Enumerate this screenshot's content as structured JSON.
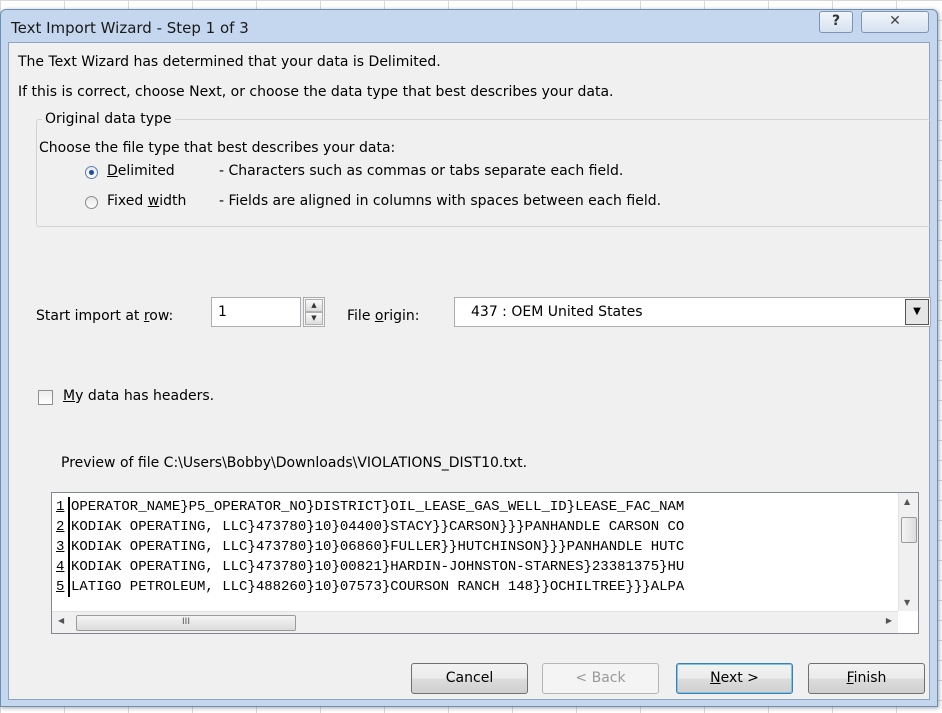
{
  "window": {
    "title": "Text Import Wizard - Step 1 of 3",
    "help_glyph": "?",
    "close_glyph": "✕"
  },
  "intro": {
    "line1": "The Text Wizard has determined that your data is Delimited.",
    "line2": "If this is correct, choose Next, or choose the data type that best describes your data."
  },
  "data_type": {
    "group_label": "Original data type",
    "prompt": "Choose the file type that best describes your data:",
    "options": [
      {
        "mnemonic": "D",
        "label_rest": "elimited",
        "description": "- Characters such as commas or tabs separate each field.",
        "selected": true
      },
      {
        "label_pre": "Fixed ",
        "mnemonic": "w",
        "label_rest": "idth",
        "description": "- Fields are aligned in columns with spaces between each field.",
        "selected": false
      }
    ]
  },
  "start_row": {
    "label_pre": "Start import at ",
    "mnemonic": "r",
    "label_rest": "ow:",
    "value": "1"
  },
  "file_origin": {
    "label_pre": "File ",
    "mnemonic": "o",
    "label_rest": "rigin:",
    "value": "437 : OEM United States"
  },
  "headers": {
    "mnemonic": "M",
    "label_rest": "y data has headers.",
    "checked": false
  },
  "preview": {
    "label": "Preview of file C:\\Users\\Bobby\\Downloads\\VIOLATIONS_DIST10.txt.",
    "rows": [
      {
        "n": "1",
        "text": "OPERATOR_NAME}P5_OPERATOR_NO}DISTRICT}OIL_LEASE_GAS_WELL_ID}LEASE_FAC_NAM"
      },
      {
        "n": "2",
        "text": "KODIAK OPERATING, LLC}473780}10}04400}STACY}}CARSON}}}PANHANDLE CARSON CO"
      },
      {
        "n": "3",
        "text": "KODIAK OPERATING, LLC}473780}10}06860}FULLER}}HUTCHINSON}}}PANHANDLE HUTC"
      },
      {
        "n": "4",
        "text": "KODIAK OPERATING, LLC}473780}10}00821}HARDIN-JOHNSTON-STARNES}23381375}HU"
      },
      {
        "n": "5",
        "text": "LATIGO PETROLEUM, LLC}488260}10}07573}COURSON RANCH 148}}OCHILTREE}}}ALPA"
      }
    ],
    "hthumb_grip": "III"
  },
  "buttons": {
    "cancel": "Cancel",
    "back": "< Back",
    "next_mnemonic": "N",
    "next_rest": "ext >",
    "finish_mnemonic": "F",
    "finish_rest": "inish"
  },
  "colors": {
    "title_frame": "#c4d7ee",
    "client_bg": "#f0f0f0",
    "default_button_border": "#3c7fb1"
  },
  "icons": {
    "scroll_up": "▲",
    "scroll_down": "▼",
    "scroll_left": "◀",
    "scroll_right": "▶",
    "dropdown": "▼"
  }
}
